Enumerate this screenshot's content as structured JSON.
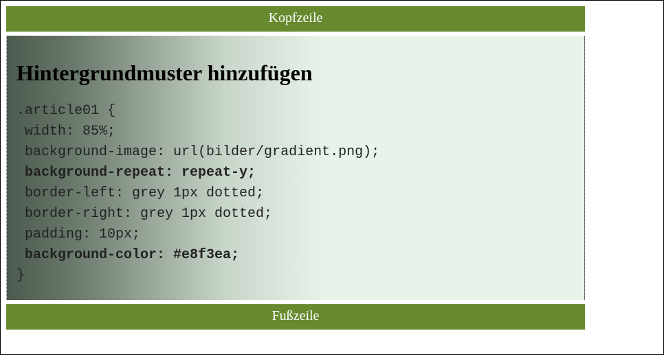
{
  "header": {
    "text": "Kopfzeile"
  },
  "footer": {
    "text": "Fußzeile"
  },
  "article": {
    "heading": "Hintergrundmuster hinzufügen",
    "code": {
      "line1": ".article01 {",
      "line2": " width: 85%;",
      "line3": " background-image: url(bilder/gradient.png);",
      "line4": " background-repeat: repeat-y;",
      "line5": " border-left: grey 1px dotted;",
      "line6": " border-right: grey 1px dotted;",
      "line7": " padding: 10px;",
      "line8": " background-color: #e8f3ea;",
      "line9": "}"
    }
  }
}
